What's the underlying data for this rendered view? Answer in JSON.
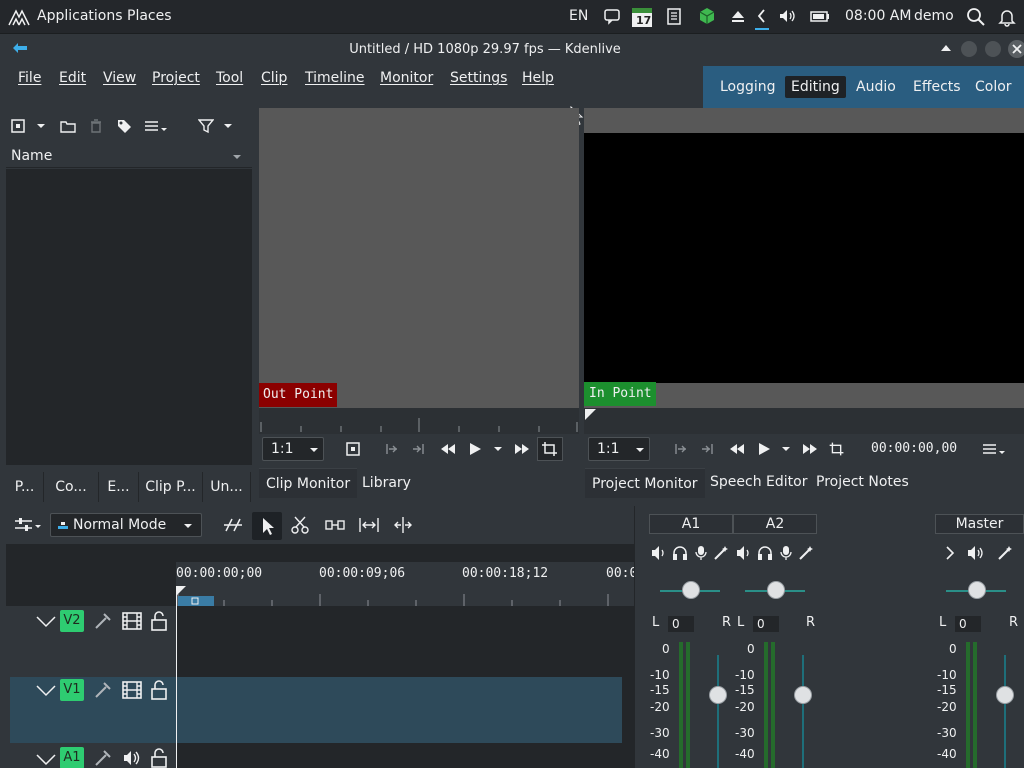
{
  "system_bar": {
    "applications": "Applications",
    "places": "Places",
    "lang": "EN",
    "calendar_day": "17",
    "clock": "08:00 AM",
    "user": "demo"
  },
  "window": {
    "title": "Untitled / HD 1080p 29.97 fps — Kdenlive"
  },
  "menu": [
    "File",
    "Edit",
    "View",
    "Project",
    "Tool",
    "Clip",
    "Timeline",
    "Monitor",
    "Settings",
    "Help"
  ],
  "layouts": {
    "items": [
      "Logging",
      "Editing",
      "Audio",
      "Effects",
      "Color"
    ],
    "active": "Editing"
  },
  "bin": {
    "column_name": "Name",
    "tabs": [
      "P...",
      "Co...",
      "E...",
      "Clip P...",
      "Un..."
    ]
  },
  "clip_monitor": {
    "out_point": "Out Point",
    "zoom": "1:1",
    "tabs": [
      "Clip Monitor",
      "Library"
    ]
  },
  "project_monitor": {
    "in_point": "In Point",
    "zoom": "1:1",
    "timecode": "00:00:00,00",
    "tabs": [
      "Project Monitor",
      "Speech Editor",
      "Project Notes"
    ]
  },
  "timeline": {
    "mode": "Normal Mode",
    "ruler": [
      "00:00:00;00",
      "00:00:09;06",
      "00:00:18;12",
      "00:0"
    ],
    "tracks": [
      "V2",
      "V1",
      "A1"
    ]
  },
  "mixer": {
    "channels": [
      "A1",
      "A2"
    ],
    "master": "Master",
    "vol_values": [
      "0",
      "0",
      "0"
    ],
    "scale": [
      "0",
      "-10",
      "-15",
      "-20",
      "-30",
      "-40"
    ],
    "left": "L",
    "right": "R"
  },
  "colors": {
    "accent": "#2a5d80",
    "in_point": "#1c8f2e",
    "out_point": "#8b0000",
    "track_badge": "#2ecc71"
  }
}
